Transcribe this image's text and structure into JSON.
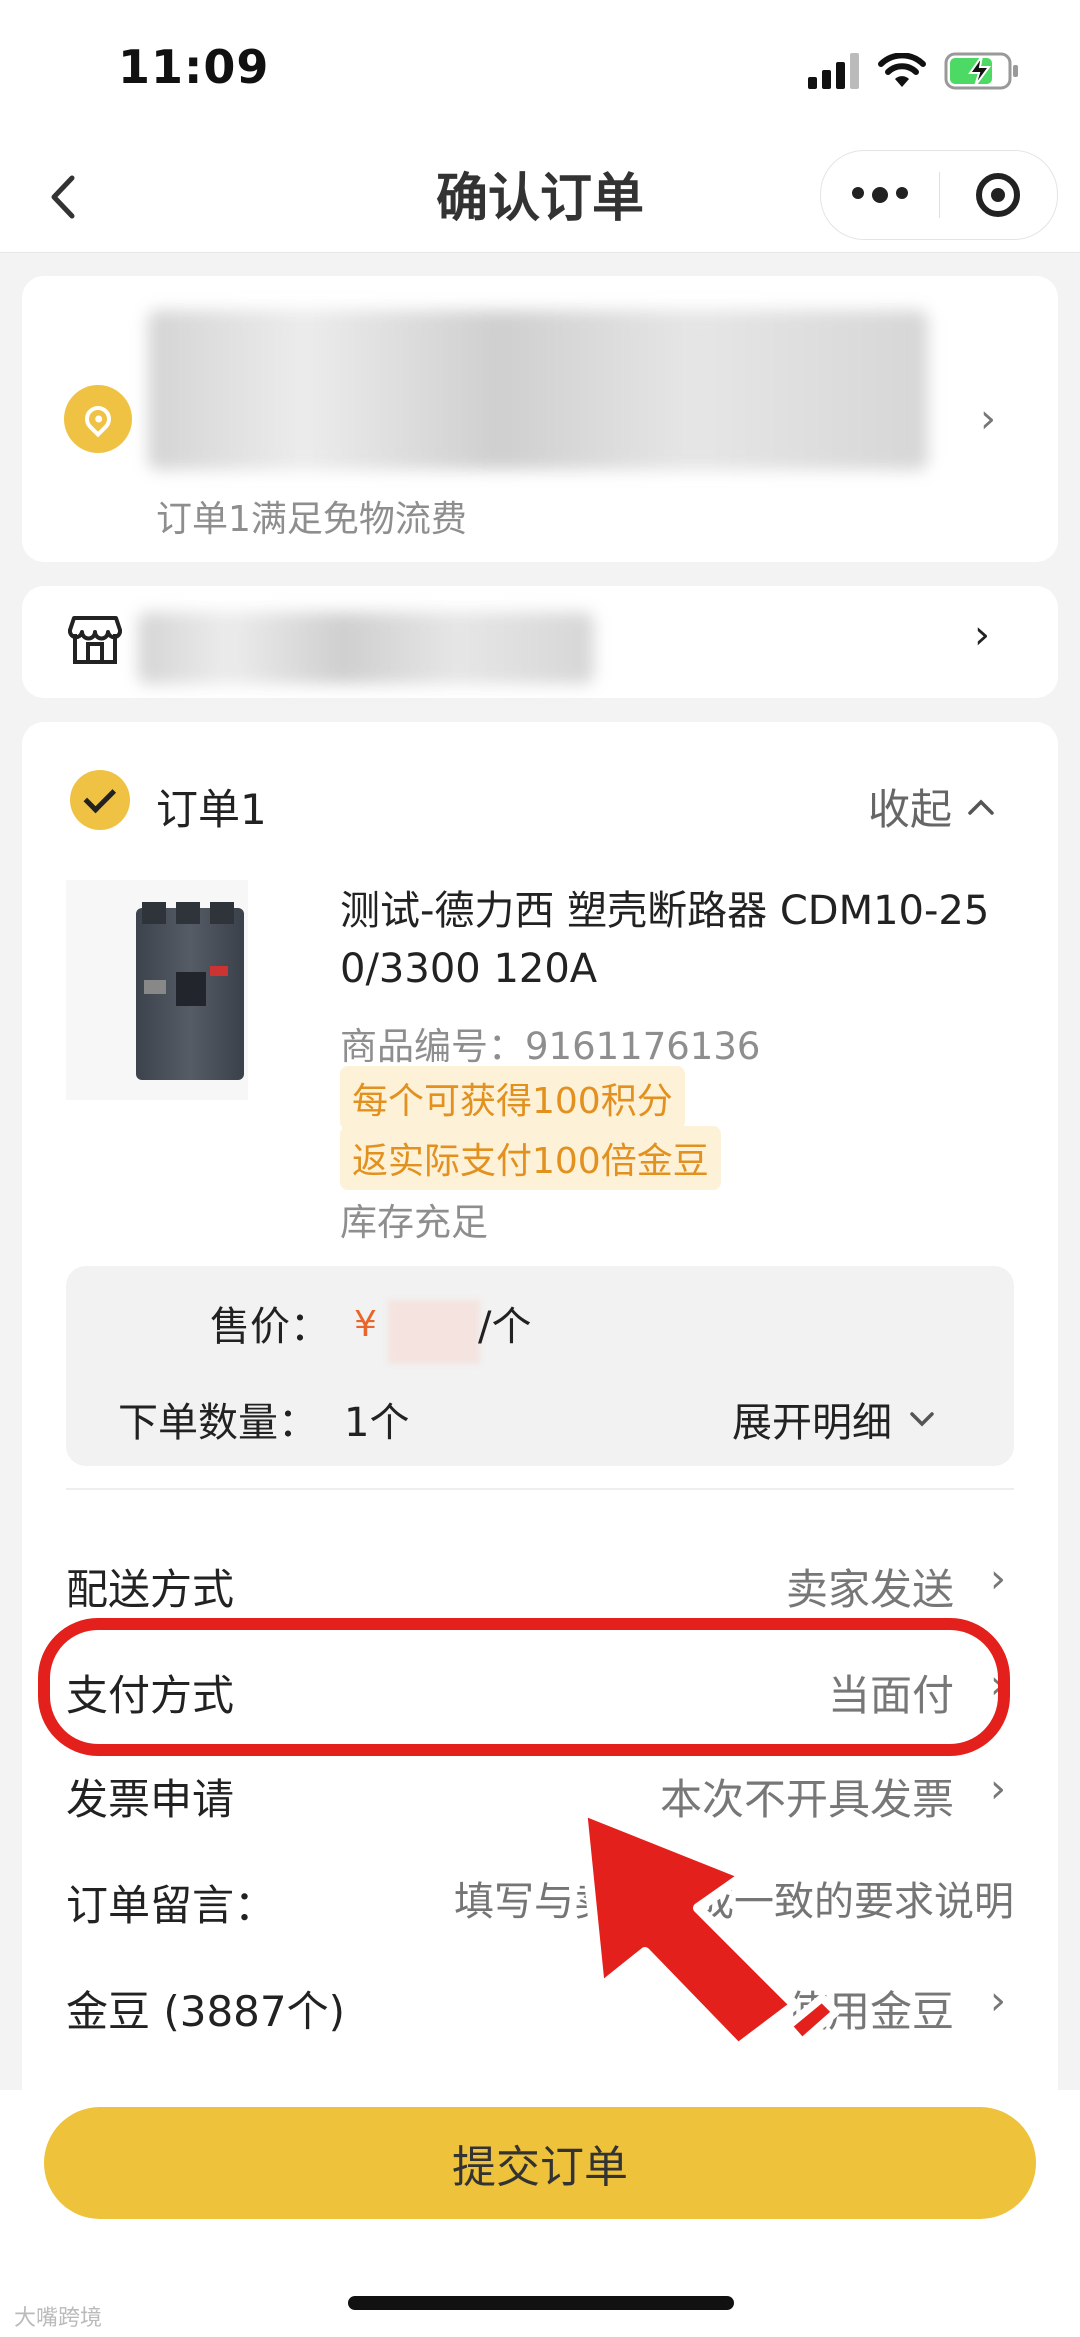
{
  "status_bar": {
    "time": "11:09"
  },
  "nav": {
    "title": "确认订单"
  },
  "address": {
    "note": "订单1满足免物流费"
  },
  "order": {
    "title": "订单1",
    "collapse_label": "收起",
    "product": {
      "name_line1": "测试-德力西 塑壳断路器 CDM10-25",
      "name_line2": "0/3300 120A",
      "sku_label": "商品编号：",
      "sku": "9161176136",
      "tag1": "每个可获得100积分",
      "tag2": "返实际支付100倍金豆",
      "stock": "库存充足"
    },
    "price_label": "售价：",
    "currency": "¥",
    "price_unit": "/个",
    "qty_label": "下单数量：",
    "qty": "1个",
    "expand_label": "展开明细"
  },
  "rows": {
    "delivery": {
      "label": "配送方式",
      "value": "卖家发送"
    },
    "payment": {
      "label": "支付方式",
      "value": "当面付"
    },
    "invoice": {
      "label": "发票申请",
      "value": "本次不开具发票"
    },
    "message": {
      "label": "订单留言：",
      "placeholder": "填写与卖家达成一致的要求说明"
    },
    "beans": {
      "label": "金豆 (3887个)",
      "value": "不使用金豆"
    }
  },
  "submit": {
    "label": "提交订单"
  },
  "watermark": "大嘴跨境",
  "colors": {
    "accent": "#efc23b",
    "price": "#e8662a",
    "highlight": "#e3201b",
    "tag_text": "#e2911f"
  }
}
